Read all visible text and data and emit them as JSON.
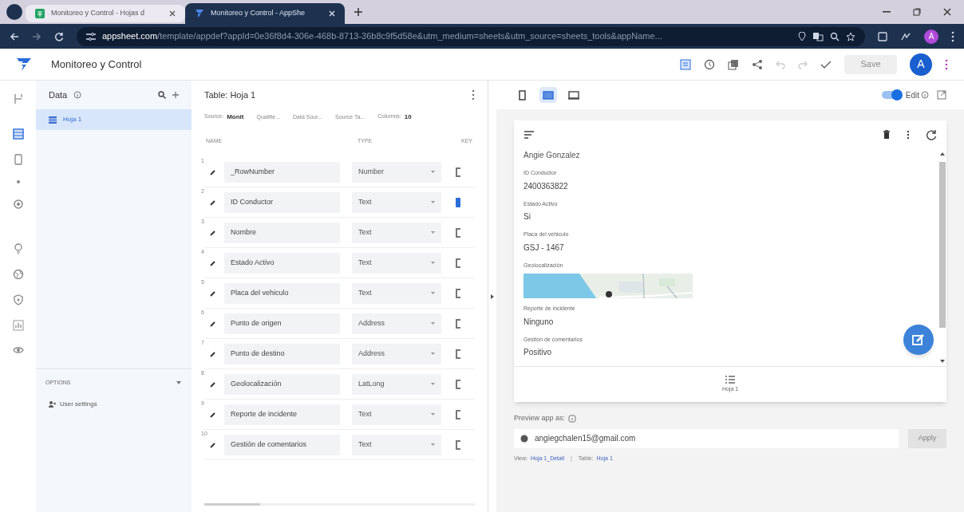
{
  "browser": {
    "tabs": [
      {
        "label": "Monitoreo y Control - Hojas d",
        "kind": "sheets",
        "selected": false
      },
      {
        "label": "Monitoreo y Control - AppShe",
        "kind": "appsheet",
        "selected": true
      }
    ],
    "url_host": "appsheet.com",
    "url_path": "/template/appdef?appId=0e36f8d4-306e-468b-8713-36b8c9f5d58e&utm_medium=sheets&utm_source=sheets_tools&appName...",
    "profile": "A"
  },
  "app": {
    "title": "Monitoreo y Control",
    "save": "Save",
    "avatar": "A"
  },
  "data_panel": {
    "title": "Data",
    "tables": [
      {
        "label": "Hoja 1",
        "selected": true
      }
    ],
    "options_title": "OPTIONS",
    "options_items": [
      "User settings"
    ]
  },
  "table": {
    "title": "Table: Hoja 1",
    "props": [
      {
        "label": "Source:",
        "value": "Monit"
      },
      {
        "label": "Qualifie..."
      },
      {
        "label": "Data Sour..."
      },
      {
        "label": "Source Ta..."
      },
      {
        "label": "Columns:",
        "value": "10"
      }
    ],
    "columns": [
      "NAME",
      "TYPE",
      "KEY"
    ],
    "rows": [
      {
        "num": "1",
        "name": "_RowNumber",
        "type": "Number",
        "key": false
      },
      {
        "num": "2",
        "name": "ID Conductor",
        "type": "Text",
        "key": true
      },
      {
        "num": "3",
        "name": "Nombre",
        "type": "Text",
        "key": false
      },
      {
        "num": "4",
        "name": "Estado Activo",
        "type": "Text",
        "key": false
      },
      {
        "num": "5",
        "name": "Placa del vehiculo",
        "type": "Text",
        "key": false
      },
      {
        "num": "6",
        "name": "Punto de origen",
        "type": "Address",
        "key": false
      },
      {
        "num": "7",
        "name": "Punto de destino",
        "type": "Address",
        "key": false
      },
      {
        "num": "8",
        "name": "Geolocalización",
        "type": "LatLong",
        "key": false
      },
      {
        "num": "9",
        "name": "Reporte de incidente",
        "type": "Text",
        "key": false
      },
      {
        "num": "10",
        "name": "Gestión de comentarios",
        "type": "Text",
        "key": false
      }
    ]
  },
  "preview": {
    "devices": [
      {
        "kind": "phone",
        "selected": false
      },
      {
        "kind": "tablet",
        "selected": true
      },
      {
        "kind": "desktop",
        "selected": false
      }
    ],
    "edit_on": true,
    "edit_label": "Edit",
    "header_value": "Angie Gonzalez",
    "fields": [
      {
        "label": "ID Conductor",
        "value": "2400363822",
        "kind": "text"
      },
      {
        "label": "Estado Activo",
        "value": "Si",
        "kind": "text"
      },
      {
        "label": "Placa del vehiculo",
        "value": "GSJ - 1467",
        "kind": "text"
      },
      {
        "label": "Geolocalización",
        "kind": "map"
      },
      {
        "label": "Reporte de incidente",
        "value": "Ninguno",
        "kind": "text"
      },
      {
        "label": "Gestión de comentarios",
        "value": "Positivo",
        "kind": "text"
      }
    ],
    "nav_label": "Hoja 1",
    "preview_as": "Preview app as:",
    "email": "angiegchalen15@gmail.com",
    "apply": "Apply",
    "view_label": "View:",
    "view_value": "Hoja 1_Detail",
    "sep": "|",
    "table_label": "Table:",
    "table_value": "Hoja 1"
  }
}
